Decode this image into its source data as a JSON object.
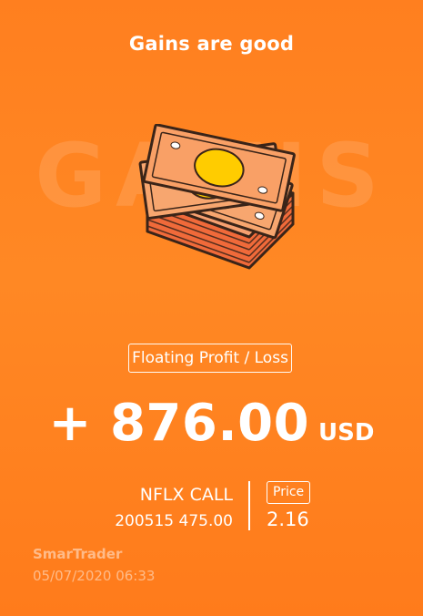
{
  "header": {
    "title": "Gains are good"
  },
  "hero": {
    "background_word": "GAINS",
    "illustration": "money-stack-icon"
  },
  "summary": {
    "label": "Floating Profit / Loss",
    "amount": "+ 876.00",
    "currency": "USD"
  },
  "position": {
    "contract": "NFLX CALL",
    "detail": "200515 475.00",
    "price_label": "Price",
    "price_value": "2.16"
  },
  "footer": {
    "brand": "SmarTrader",
    "timestamp": "05/07/2020 06:33"
  },
  "colors": {
    "background": "#ff8322",
    "text": "#ffffff",
    "bill": "#f9a066",
    "coin": "#ffcc00",
    "outline": "#3a2418"
  }
}
